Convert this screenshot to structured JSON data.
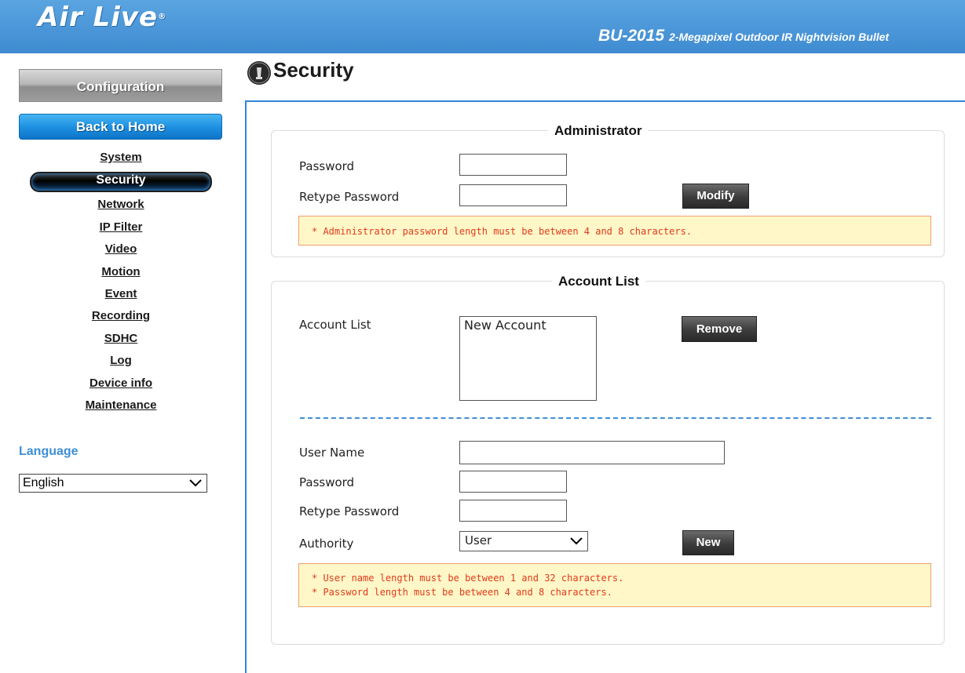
{
  "header": {
    "logo": "Air Live",
    "model": "BU-2015",
    "model_desc": "2-Megapixel Outdoor IR Nightvision Bullet"
  },
  "sidebar": {
    "config_label": "Configuration",
    "home_label": "Back to Home",
    "items": [
      {
        "label": "System"
      },
      {
        "label": "Security",
        "active": true
      },
      {
        "label": "Network"
      },
      {
        "label": "IP Filter"
      },
      {
        "label": "Video"
      },
      {
        "label": "Motion"
      },
      {
        "label": "Event"
      },
      {
        "label": "Recording"
      },
      {
        "label": "SDHC"
      },
      {
        "label": "Log"
      },
      {
        "label": "Device info"
      },
      {
        "label": "Maintenance"
      }
    ],
    "language_title": "Language",
    "language_value": "English"
  },
  "page": {
    "title": "Security",
    "icon": "security-icon"
  },
  "administrator": {
    "legend": "Administrator",
    "password_label": "Password",
    "password_value": "",
    "retype_label": "Retype Password",
    "retype_value": "",
    "modify_label": "Modify",
    "note": "* Administrator password length must be between 4 and 8 characters."
  },
  "account_list": {
    "legend": "Account List",
    "list_label": "Account List",
    "accounts": [
      "New Account"
    ],
    "remove_label": "Remove",
    "username_label": "User Name",
    "username_value": "",
    "password_label": "Password",
    "password_value": "",
    "retype_label": "Retype Password",
    "retype_value": "",
    "authority_label": "Authority",
    "authority_value": "User",
    "new_label": "New",
    "notes": [
      "* User name length must be between 1 and 32 characters.",
      "* Password length must be between 4 and 8 characters."
    ]
  },
  "colors": {
    "header_blue": "#3f8bd1",
    "accent_blue": "#2f86d8",
    "note_bg": "#fff7c8",
    "note_text": "#e03a1a"
  }
}
